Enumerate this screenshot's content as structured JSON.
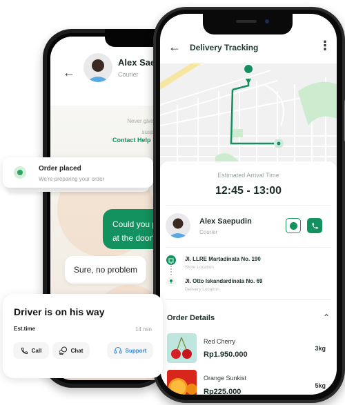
{
  "chat_screen": {
    "back_icon": "arrow-left-icon",
    "courier_name": "Alex Sae",
    "courier_role": "Courier",
    "notice_line1": "Never give your personal data",
    "notice_line2": "suspicious happens, ple",
    "contact_help": "Contact Help",
    "messages": [
      {
        "from": "me",
        "text_line1": "Could you ple",
        "text_line2": "at the door?"
      },
      {
        "from": "courier",
        "text": "Sure, no problem"
      }
    ]
  },
  "order_card": {
    "status_icon": "status-dot-icon",
    "title": "Order placed",
    "subtitle": "We're preparing your order"
  },
  "driver_card": {
    "title": "Driver is on his way",
    "est_label": "Est.time",
    "est_value": "14 min",
    "actions": [
      {
        "label": "Call",
        "icon": "phone-icon"
      },
      {
        "label": "Chat",
        "icon": "chat-bubbles-icon"
      },
      {
        "label": "Support",
        "icon": "headset-icon"
      }
    ]
  },
  "tracking": {
    "header": {
      "back_icon": "arrow-left-icon",
      "title": "Delivery Tracking",
      "menu_icon": "more-vertical-icon"
    },
    "eta": {
      "label": "Estimated Arrival Time",
      "value": "12:45 - 13:00"
    },
    "courier": {
      "name": "Alex Saepudin",
      "role": "Courier",
      "chat_icon": "chat-icon",
      "call_icon": "phone-icon"
    },
    "locations": [
      {
        "address": "Jl. LLRE Martadinata No. 190",
        "type": "Store Location",
        "icon": "store-icon"
      },
      {
        "address": "Jl. Otto Iskandardinata No. 69",
        "type": "Delivery Location",
        "icon": "pin-icon"
      }
    ],
    "order_details": {
      "title": "Order Details",
      "toggle_icon": "chevron-up-icon",
      "items": [
        {
          "name": "Red Cherry",
          "price": "Rp1.950.000",
          "qty": "3kg",
          "image": "cherry-image"
        },
        {
          "name": "Orange Sunkist",
          "price": "Rp225.000",
          "qty": "5kg",
          "image": "orange-image"
        }
      ]
    }
  },
  "colors": {
    "brand_green": "#13915f",
    "route_green": "#148e5e",
    "support_blue": "#2a86e0"
  }
}
